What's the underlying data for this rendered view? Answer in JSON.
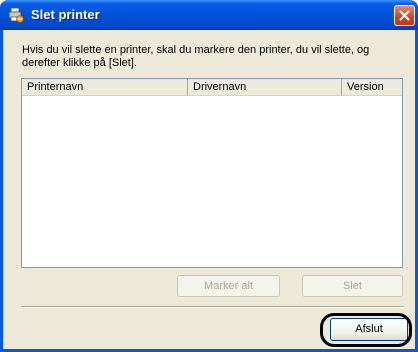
{
  "window": {
    "title": "Slet printer",
    "message": "Hvis du vil slette en printer, skal du markere den printer, du vil slette, og derefter klikke på [Slet]."
  },
  "list": {
    "columns": [
      "Printernavn",
      "Drivernavn",
      "Version"
    ],
    "rows": []
  },
  "buttons": {
    "select_all": "Marker alt",
    "delete": "Slet",
    "exit": "Afslut"
  },
  "icons": {
    "title": "printer-remove-icon",
    "close": "close-icon"
  },
  "colors": {
    "title_bar": "#0052d9",
    "dialog_bg": "#ece9d8",
    "close_button": "#d5421f"
  }
}
